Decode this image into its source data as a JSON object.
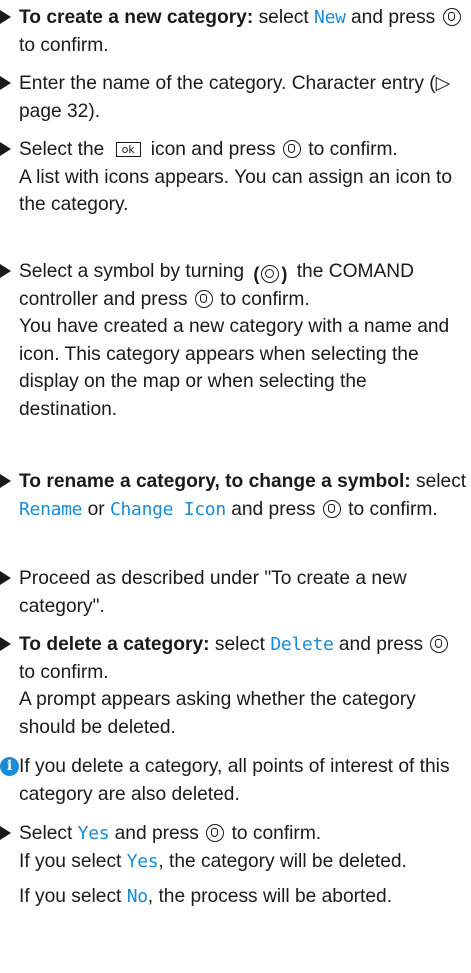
{
  "icons": {
    "bullet": "triangle-bullet-icon",
    "press": "press-controller-icon",
    "turn": "turn-controller-icon",
    "ok": "ok-icon",
    "info": "info-icon"
  },
  "colors": {
    "accent": "#1a8bd6",
    "text": "#1a1a1a"
  },
  "step1": {
    "bold": "To create a new category:",
    "t1": " select ",
    "ui": "New",
    "t2": " and press ",
    "t3": " to confirm."
  },
  "step2": {
    "text": "Enter the name of the category. Character entry (▷ page 32)."
  },
  "step3": {
    "t1": "Select the ",
    "ok": "ok",
    "t2": "icon and press ",
    "t3": " to confirm.",
    "result": "A list with icons appears. You can assign an icon to the category."
  },
  "step4": {
    "t1": "Select a symbol by turning ",
    "t2": " the COMAND controller and press ",
    "t3": " to confirm.",
    "result": "You have created a new category with a name and icon. This category appears when selecting the display on the map or when selecting the destination."
  },
  "step5": {
    "bold": "To rename a category, to change a symbol:",
    "t1": " select ",
    "ui1": "Rename",
    "t2": " or ",
    "ui2": "Change Icon",
    "t3": " and press ",
    "t4": " to confirm."
  },
  "step6": {
    "text": "Proceed as described under \"To create a new category\"."
  },
  "step7": {
    "bold": "To delete a category:",
    "t1": " select ",
    "ui": "Delete",
    "t2": " and press ",
    "t3": " to confirm.",
    "result": "A prompt appears asking whether the category should be deleted."
  },
  "note": {
    "text": "If you delete a category, all points of interest of this category are also deleted."
  },
  "step8": {
    "t1": "Select ",
    "ui": "Yes",
    "t2": " and press ",
    "t3": " to confirm.",
    "r1a": "If you select ",
    "r1ui": "Yes",
    "r1b": ", the category will be deleted.",
    "r2a": "If you select ",
    "r2ui": "No",
    "r2b": ", the process will be aborted."
  }
}
